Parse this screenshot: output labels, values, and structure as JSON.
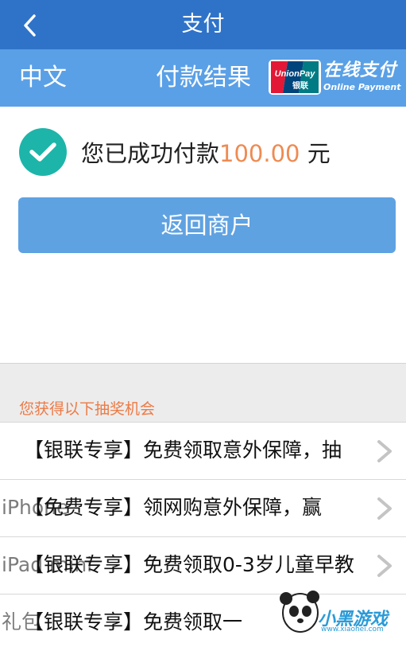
{
  "header": {
    "title": "支付"
  },
  "subheader": {
    "language": "中文",
    "result_title": "付款结果",
    "logo_text": "UnionPay",
    "logo_cn": "银联",
    "online_pay_cn": "在线支付",
    "online_pay_en": "Online Payment"
  },
  "success": {
    "prefix": "您已成功付款",
    "amount": "100.00",
    "unit": "元"
  },
  "return_button": "返回商户",
  "lottery": {
    "label": "您获得以下抽奖机会",
    "items": [
      {
        "text": "【银联专享】免费领取意外保障，抽",
        "ghost": ""
      },
      {
        "text": "【免费专享】领网购意外保障，赢",
        "ghost": "iPhone"
      },
      {
        "text": "【银联专享】免费领取0-3岁儿童早教",
        "ghost": "iPad mini"
      },
      {
        "text": "【银联专享】免费领取一",
        "ghost": "礼包"
      }
    ]
  },
  "watermark": {
    "text": "小黑游戏",
    "url": "www.xiaohei.com"
  },
  "colors": {
    "header_bg": "#2f73c9",
    "subheader_bg": "#5aa0e6",
    "success_check": "#1db5a9",
    "amount": "#ee8b52",
    "button_bg": "#5fa2e2",
    "lottery_label": "#ec7a45"
  }
}
